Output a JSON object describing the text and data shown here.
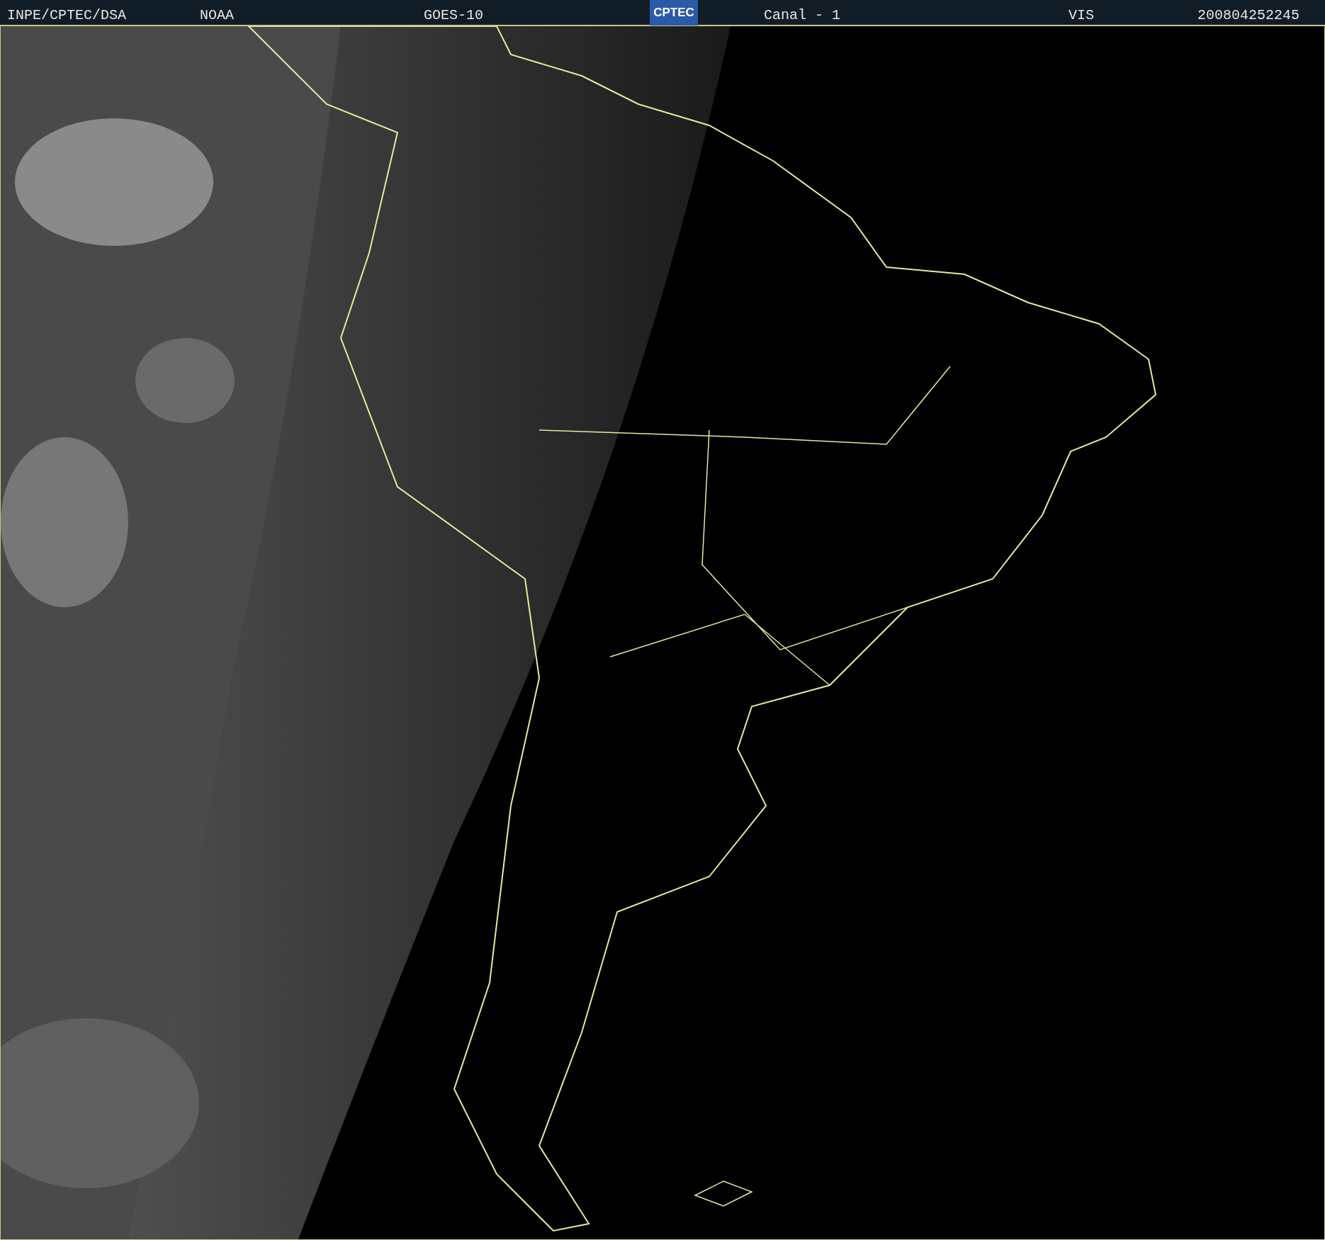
{
  "header": {
    "items": [
      {
        "kind": "text",
        "text": "INPE/CPTEC/DSA"
      },
      {
        "kind": "text",
        "text": "NOAA"
      },
      {
        "kind": "text",
        "text": "GOES-10"
      },
      {
        "kind": "logo",
        "text": "CPTEC"
      },
      {
        "kind": "text",
        "text": "Canal - 1"
      },
      {
        "kind": "text",
        "text": "VIS"
      },
      {
        "kind": "text",
        "text": "200804252245"
      }
    ]
  }
}
